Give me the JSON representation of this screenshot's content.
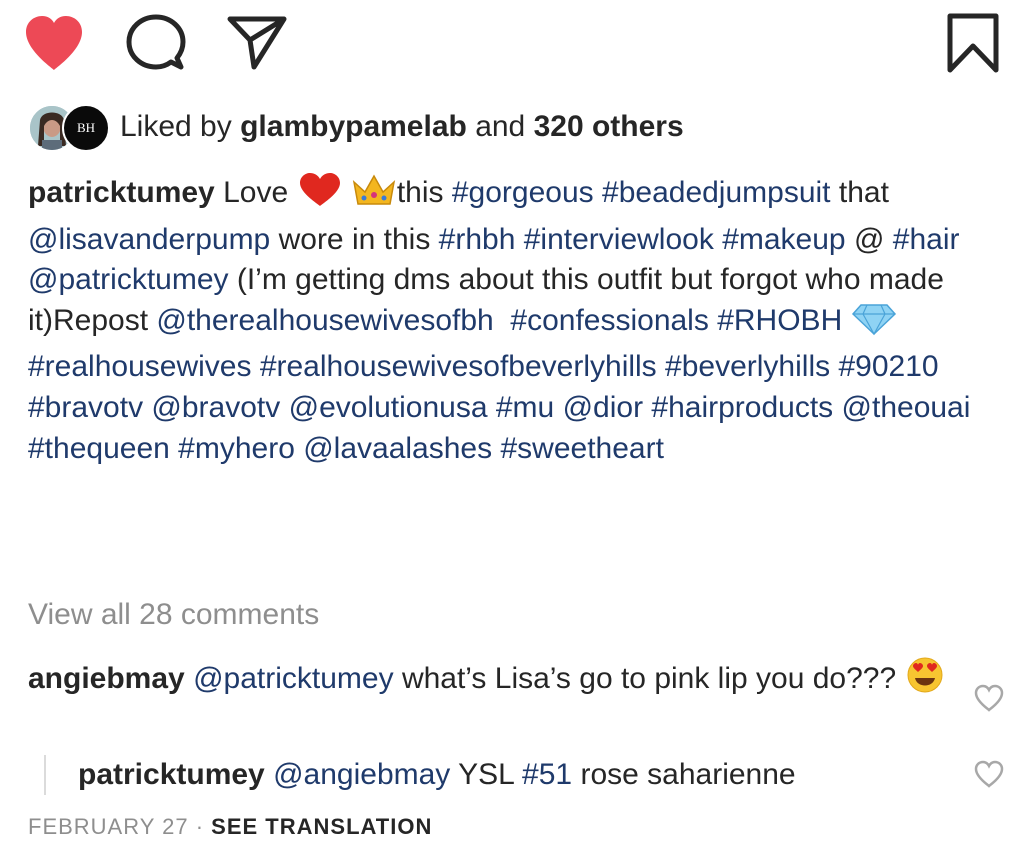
{
  "actions": {
    "like_icon": "heart-filled-icon",
    "comment_icon": "speech-bubble-icon",
    "share_icon": "paper-plane-icon",
    "save_icon": "bookmark-icon",
    "like_color": "#ed4956"
  },
  "likes": {
    "prefix": "Liked by",
    "liker": "glambypamelab",
    "and": "and",
    "others": "320 others",
    "avatar2_text": "BH"
  },
  "caption": {
    "username": "patricktumey",
    "t1": "Love",
    "t2": "this",
    "h_gorgeous": "#gorgeous",
    "h_beaded": "#beadedjumpsuit",
    "t3": "that",
    "m_lisa": "@lisavanderpump",
    "t4": "wore in this",
    "h_rhbh": "#rhbh",
    "h_interview": "#interviewlook",
    "h_makeup": "#makeup",
    "t5": "@",
    "h_hair": "#hair",
    "m_patrick": "@patricktumey",
    "t6": "(I’m getting dms about this outfit but forgot who made it)Repost",
    "m_therealhw": "@therealhousewivesofbh",
    "h_confessionals": "#confessionals",
    "h_rhobh": "#RHOBH",
    "h_realhw": "#realhousewives",
    "h_realhwbh": "#realhousewivesofbeverlyhills",
    "h_beverlyhills": "#beverlyhills",
    "h_90210": "#90210",
    "h_bravotv": "#bravotv",
    "m_bravotv": "@bravotv",
    "m_evolution": "@evolutionusa",
    "h_mu": "#mu",
    "m_dior": "@dior",
    "h_hairproducts": "#hairproducts",
    "m_theouai": "@theouai",
    "h_thequeen": "#thequeen",
    "h_myhero": "#myhero",
    "m_lavaa": "@lavaalashes",
    "h_sweetheart": "#sweetheart"
  },
  "view_all_comments": "View all 28 comments",
  "comments": [
    {
      "username": "angiebmay",
      "mention": "@patricktumey",
      "text": "what’s Lisa’s go to pink lip you do???"
    }
  ],
  "reply": {
    "username": "patricktumey",
    "mention": "@angiebmay",
    "t1": "YSL",
    "hashtag": "#51",
    "t2": "rose saharienne"
  },
  "footer": {
    "date": "FEBRUARY 27",
    "separator": "·",
    "translation": "SEE TRANSLATION"
  }
}
